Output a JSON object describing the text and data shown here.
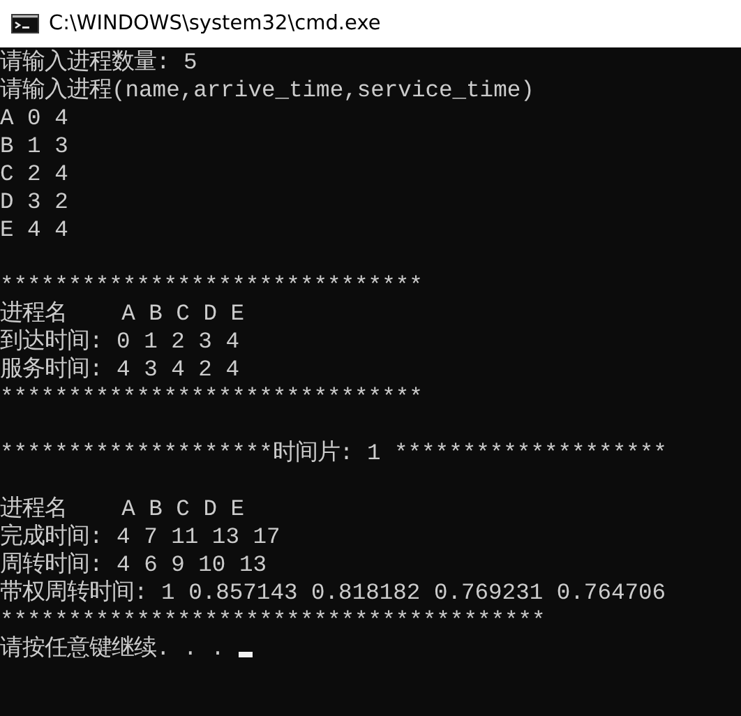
{
  "window": {
    "title": "C:\\WINDOWS\\system32\\cmd.exe"
  },
  "console": {
    "lines": [
      {
        "kind": "output",
        "text": "请输入进程数量: 5"
      },
      {
        "kind": "output",
        "text": "请输入进程(name,arrive_time,service_time)"
      },
      {
        "kind": "output",
        "text": "A 0 4"
      },
      {
        "kind": "output",
        "text": "B 1 3"
      },
      {
        "kind": "output",
        "text": "C 2 4"
      },
      {
        "kind": "output",
        "text": "D 3 2"
      },
      {
        "kind": "output",
        "text": "E 4 4"
      },
      {
        "kind": "blank"
      },
      {
        "kind": "output",
        "text": "*******************************"
      },
      {
        "kind": "output",
        "text": "进程名    A B C D E"
      },
      {
        "kind": "output",
        "text": "到达时间: 0 1 2 3 4"
      },
      {
        "kind": "output",
        "text": "服务时间: 4 3 4 2 4"
      },
      {
        "kind": "output",
        "text": "*******************************"
      },
      {
        "kind": "blank"
      },
      {
        "kind": "output",
        "text": "********************时间片: 1 ********************"
      },
      {
        "kind": "blank"
      },
      {
        "kind": "output",
        "text": "进程名    A B C D E"
      },
      {
        "kind": "output",
        "text": "完成时间: 4 7 11 13 17"
      },
      {
        "kind": "output",
        "text": "周转时间: 4 6 9 10 13"
      },
      {
        "kind": "output",
        "text": "带权周转时间: 1 0.857143 0.818182 0.769231 0.764706"
      },
      {
        "kind": "output",
        "text": "****************************************"
      },
      {
        "kind": "prompt",
        "text": "请按任意键继续. . ."
      }
    ]
  }
}
